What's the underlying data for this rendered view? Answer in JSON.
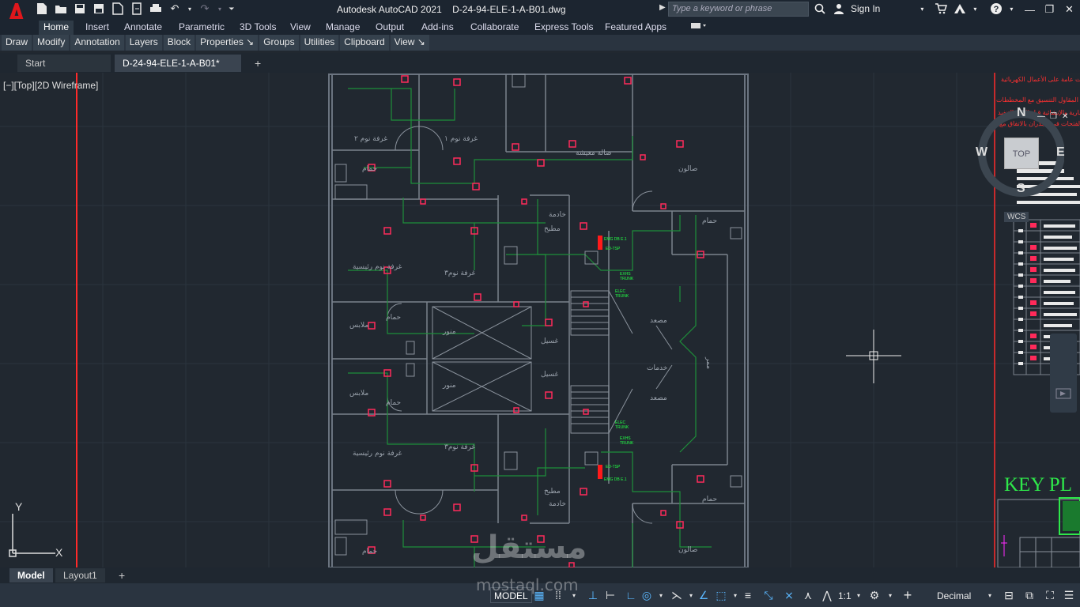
{
  "titlebar": {
    "app_name": "Autodesk AutoCAD 2021",
    "file_name": "D-24-94-ELE-1-A-B01.dwg",
    "search_placeholder": "Type a keyword or phrase",
    "sign_in": "Sign In"
  },
  "ribbon": {
    "tabs": [
      "Home",
      "Insert",
      "Annotate",
      "Parametric",
      "3D Tools",
      "View",
      "Manage",
      "Output",
      "Add-ins",
      "Collaborate",
      "Express Tools",
      "Featured Apps"
    ],
    "active_tab": "Home",
    "panels": [
      "Draw",
      "Modify",
      "Annotation",
      "Layers",
      "Block",
      "Properties ↘",
      "Groups",
      "Utilities",
      "Clipboard",
      "View ↘"
    ]
  },
  "doc_tabs": {
    "start": "Start",
    "drawing": "D-24-94-ELE-1-A-B01*"
  },
  "viewport": {
    "label": "[−][Top][2D Wireframe]"
  },
  "viewcube": {
    "north": "N",
    "south": "S",
    "east": "E",
    "west": "W",
    "top": "TOP",
    "wcs": "WCS"
  },
  "ucs": {
    "x": "X",
    "y": "Y"
  },
  "rooms": {
    "bedroom2": "غرفة نوم ٢",
    "bedroom1": "غرفة نوم ١",
    "living": "صالة معيشة",
    "salon": "صالون",
    "bath": "حمام",
    "master_bed": "غرفة نوم رئيسية",
    "bedroom3": "غرفة نوم٣",
    "kitchen": "مطبخ",
    "maid": "خادمة",
    "clothes": "ملابس",
    "shaft": "منور",
    "laundry": "غسيل",
    "services": "خدمات",
    "elevator": "مصعد",
    "corridor": "ممر"
  },
  "notes": {
    "line1": "ملاحظات عامة على الأعمال الكهربائية",
    "line2": "يجب على المقاول التنسيق مع المخططات",
    "line3": "المعمارية والإنشائية قبل البدء بالتنفيذ",
    "line4": "وعمل الفتحات في الجدران بالاتفاق مع"
  },
  "keyplan": "KEY PL",
  "watermark": {
    "arabic": "مستقل",
    "latin": "mostaql.com"
  },
  "layout_tabs": [
    "Model",
    "Layout1"
  ],
  "statusbar": {
    "model": "MODEL",
    "scale": "1:1",
    "units": "Decimal"
  }
}
